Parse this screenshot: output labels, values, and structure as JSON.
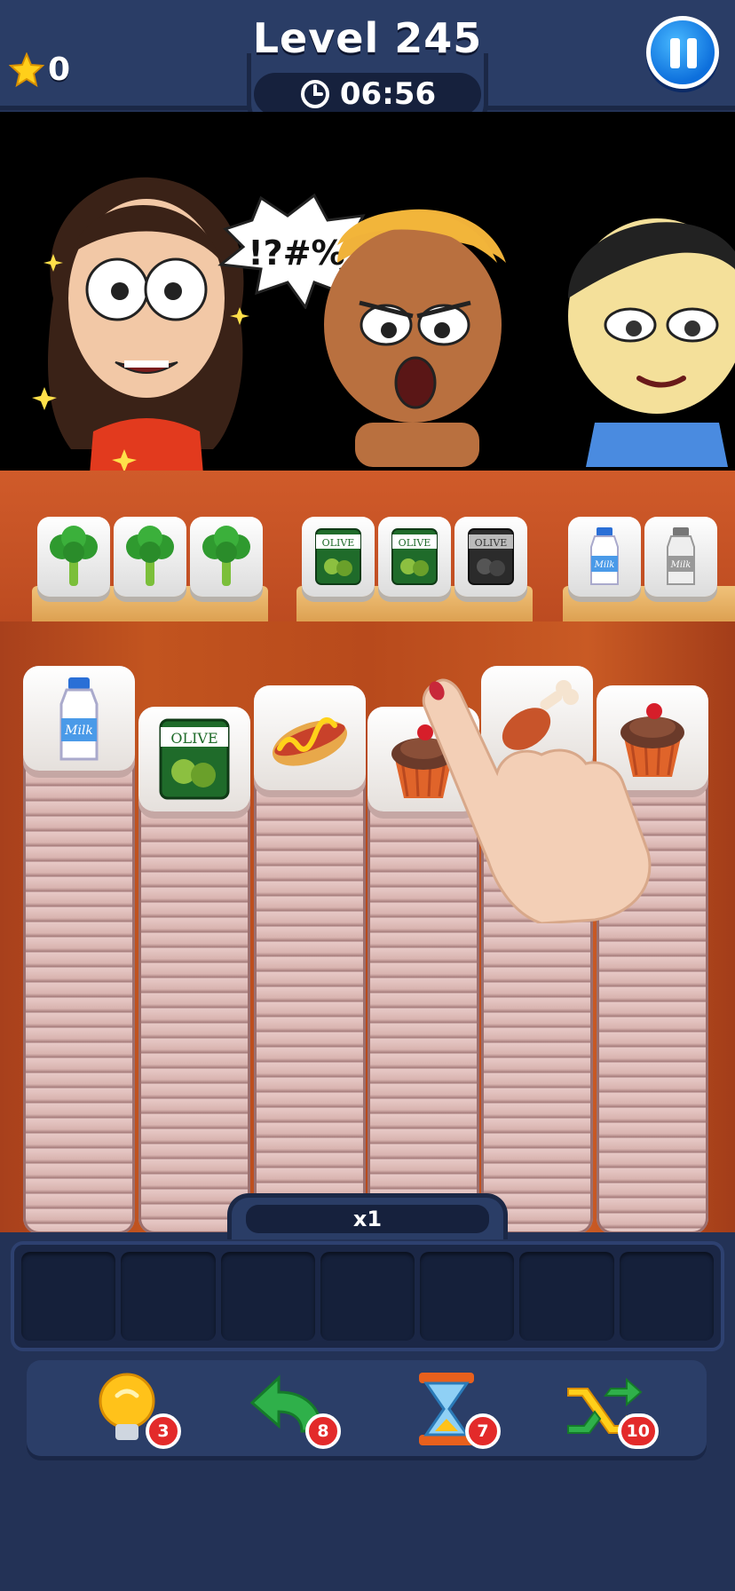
{
  "header": {
    "stars": "0",
    "level": "Level 245",
    "timer": "06:56"
  },
  "scene": {
    "speech_bubble": "!?#%",
    "orders": [
      {
        "customer": "woman",
        "items": [
          "broccoli",
          "broccoli",
          "broccoli"
        ]
      },
      {
        "customer": "bald-man",
        "items": [
          "olive-can",
          "olive-can",
          "olive-can"
        ]
      },
      {
        "customer": "man",
        "items": [
          "milk",
          "milk"
        ]
      }
    ],
    "can_label": "OLIVE",
    "milk_label": "Milk"
  },
  "board": {
    "top_tiles": [
      "milk",
      "olive-can",
      "hotdog",
      "cupcake",
      "chicken-leg",
      "cupcake"
    ]
  },
  "multiplier": "x1",
  "slots": 7,
  "boosters": [
    {
      "name": "hint",
      "icon": "lightbulb-icon",
      "count": "3"
    },
    {
      "name": "undo",
      "icon": "undo-arrow-icon",
      "count": "8"
    },
    {
      "name": "freeze-time",
      "icon": "hourglass-icon",
      "count": "7"
    },
    {
      "name": "shuffle",
      "icon": "shuffle-icon",
      "count": "10"
    }
  ],
  "colors": {
    "panel": "#2a3d66",
    "background": "#233256",
    "counter": "#c2541f",
    "badge": "#e32a2a",
    "pause": "#0d6fdc"
  }
}
